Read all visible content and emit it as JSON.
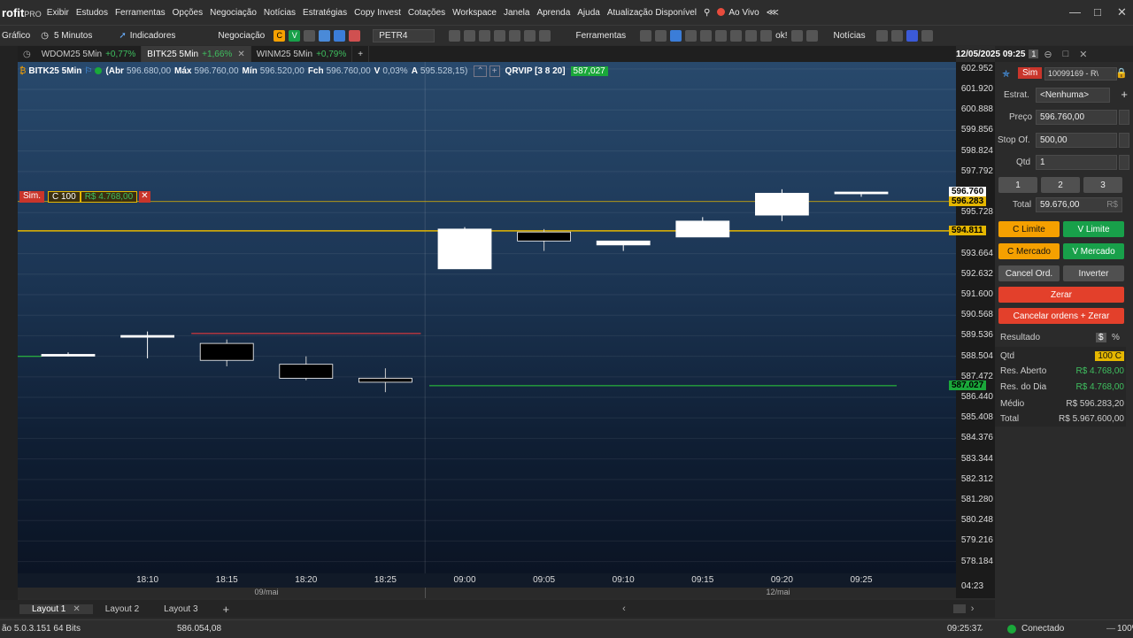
{
  "menu": {
    "logo_main": "rofit",
    "logo_sub": "PRO",
    "items": [
      "Exibir",
      "Estudos",
      "Ferramentas",
      "Opções",
      "Negociação",
      "Notícias",
      "Estratégias",
      "Copy Invest",
      "Cotações",
      "Workspace",
      "Janela",
      "Aprenda",
      "Ajuda",
      "Atualização Disponível"
    ],
    "live_label": "Ao Vivo"
  },
  "toolbar": {
    "chart_label": "Gráfico",
    "interval": "5 Minutos",
    "indicators": "Indicadores",
    "trading": "Negociação",
    "buy_short": "C",
    "sell_short": "V",
    "ticker": "PETR4",
    "tools": "Ferramentas",
    "ok_label": "ok!",
    "news": "Notícias"
  },
  "tabs": [
    {
      "label": "WDOM25 5Min",
      "change": "+0,77%"
    },
    {
      "label": "BITK25 5Min",
      "change": "+1,66%",
      "active": true
    },
    {
      "label": "WINM25 5Min",
      "change": "+0,79%"
    }
  ],
  "header_right": {
    "datetime": "12/05/2025 09:25",
    "page": "1"
  },
  "chart": {
    "symbol": "BITK25 5Min",
    "abr_label": "(Abr",
    "abr": "596.680,00",
    "max_label": "Máx",
    "max": "596.760,00",
    "min_label": "Mín",
    "min": "596.520,00",
    "fch_label": "Fch",
    "fch": "596.760,00",
    "var_label": "V",
    "var": "0,03%",
    "a_label": "A",
    "a": "595.528,15)",
    "study": "QRVIP [3 8 20]",
    "study_val": "587,027",
    "position_tag": "Sim.",
    "position_qty": "C 100",
    "position_pnl": "R$ 4.768,00"
  },
  "chart_data": {
    "type": "candlestick",
    "yticks": [
      "602.952",
      "601.920",
      "600.888",
      "599.856",
      "598.824",
      "597.792",
      "595.728",
      "593.664",
      "592.632",
      "591.600",
      "590.568",
      "589.536",
      "588.504",
      "587.472",
      "586.440",
      "585.408",
      "584.376",
      "583.344",
      "582.312",
      "581.280",
      "580.248",
      "579.216",
      "578.184"
    ],
    "price_labels": [
      {
        "text": "596.760",
        "value": 596760,
        "style": "last"
      },
      {
        "text": "596.283",
        "value": 596283,
        "style": "avg"
      },
      {
        "text": "594.811",
        "value": 594811,
        "style": "line"
      },
      {
        "text": "587.027",
        "value": 587027,
        "style": "study"
      }
    ],
    "ylim": [
      577500,
      603300
    ],
    "x": [
      "18:05",
      "18:10",
      "18:15",
      "18:20",
      "18:25",
      "09:00",
      "09:05",
      "09:10",
      "09:15",
      "09:20",
      "09:25"
    ],
    "xticks": [
      "18:10",
      "18:15",
      "18:20",
      "18:25",
      "09:00",
      "09:05",
      "09:10",
      "09:15",
      "09:20",
      "09:25"
    ],
    "candles": [
      {
        "t": "18:05",
        "o": 588600,
        "h": 588700,
        "l": 588500,
        "c": 588600
      },
      {
        "t": "18:10",
        "o": 589550,
        "h": 589750,
        "l": 588400,
        "c": 589550
      },
      {
        "t": "18:15",
        "o": 589150,
        "h": 589350,
        "l": 588000,
        "c": 588300
      },
      {
        "t": "18:20",
        "o": 588100,
        "h": 588500,
        "l": 587300,
        "c": 587400
      },
      {
        "t": "18:25",
        "o": 587400,
        "h": 587900,
        "l": 586700,
        "c": 587200
      },
      {
        "t": "09:00",
        "o": 592900,
        "h": 595000,
        "l": 592900,
        "c": 594900
      },
      {
        "t": "09:05",
        "o": 594750,
        "h": 594900,
        "l": 593800,
        "c": 594300
      },
      {
        "t": "09:10",
        "o": 594100,
        "h": 594300,
        "l": 593800,
        "c": 594300
      },
      {
        "t": "09:15",
        "o": 594500,
        "h": 595500,
        "l": 594500,
        "c": 595300
      },
      {
        "t": "09:20",
        "o": 595600,
        "h": 596900,
        "l": 595300,
        "c": 596700
      },
      {
        "t": "09:25",
        "o": 596680,
        "h": 596760,
        "l": 596520,
        "c": 596760
      }
    ],
    "dates": [
      "09/mai",
      "12/mai"
    ],
    "lines": [
      {
        "color": "#ff3b3b",
        "from": "18:15",
        "to": "18:25",
        "value": 589650
      },
      {
        "color": "#2bd13a",
        "from": "09:00",
        "to": "09:25",
        "value": 587027
      },
      {
        "color": "#2bd13a",
        "from": "18:05",
        "to": "18:05",
        "value": 588500
      }
    ],
    "grid": true
  },
  "xaxis_right": "04:23",
  "layouts": [
    "Layout 1",
    "Layout 2",
    "Layout 3"
  ],
  "panel": {
    "mode": "Sim",
    "account": "10099169 - R\\",
    "strategy_label": "Estrat.",
    "strategy": "<Nenhuma>",
    "price_label": "Preço",
    "price": "596.760,00",
    "stop_label": "Stop Of.",
    "stop": "500,00",
    "qty_label": "Qtd",
    "qty": "1",
    "quick": [
      "1",
      "2",
      "3"
    ],
    "total_label": "Total",
    "total": "59.676,00",
    "total_unit": "R$",
    "buttons": {
      "c_limite": "C Limite",
      "v_limite": "V Limite",
      "c_mercado": "C Mercado",
      "v_mercado": "V Mercado",
      "cancel": "Cancel Ord.",
      "inverter": "Inverter",
      "zerar": "Zerar",
      "cancel_zerar": "Cancelar ordens + Zerar"
    },
    "result_label": "Resultado",
    "result_currency": "$",
    "result_pct": "%",
    "rows": [
      {
        "label": "Qtd",
        "value": "100 C"
      },
      {
        "label": "Res. Aberto",
        "value": "R$ 4.768,00"
      },
      {
        "label": "Res. do Dia",
        "value": "R$ 4.768,00"
      },
      {
        "label": "Médio",
        "value": "R$ 596.283,20"
      },
      {
        "label": "Total",
        "value": "R$ 5.967.600,00"
      }
    ]
  },
  "status": {
    "version": "ão 5.0.3.151 64 Bits",
    "cursor_value": "586.054,08",
    "clock": "09:25:37",
    "connection": "Conectado",
    "zoom": "100%"
  }
}
